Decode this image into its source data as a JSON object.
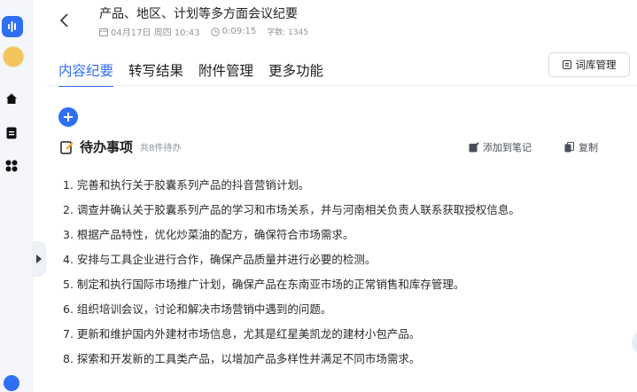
{
  "document": {
    "title": "产品、地区、计划等多方面会议纪要",
    "date": "04月17日 周四 10:43",
    "duration": "0:09:15",
    "word_count": "字数: 1345"
  },
  "tabs": [
    {
      "label": "内容纪要",
      "active": true
    },
    {
      "label": "转写结果",
      "active": false
    },
    {
      "label": "附件管理",
      "active": false
    },
    {
      "label": "更多功能",
      "active": false
    }
  ],
  "toolbar": {
    "library_label": "词库管理"
  },
  "section": {
    "title": "待办事项",
    "subtitle": "共8件待办",
    "add_note_label": "添加到笔记",
    "copy_label": "复制"
  },
  "todos": [
    "1. 完善和执行关于胶囊系列产品的抖音营销计划。",
    "2. 调查并确认关于胶囊系列产品的学习和市场关系，并与河南相关负责人联系获取授权信息。",
    "3. 根据产品特性，优化炒菜油的配方，确保符合市场需求。",
    "4. 安排与工具企业进行合作，确保产品质量并进行必要的检测。",
    "5. 制定和执行国际市场推广计划，确保产品在东南亚市场的正常销售和库存管理。",
    "6. 组织培训会议，讨论和解决市场营销中遇到的问题。",
    "7. 更新和维护国内外建材市场信息，尤其是红星美凯龙的建材小包产品。",
    "8. 探索和开发新的工具类产品，以增加产品多样性并满足不同市场需求。"
  ],
  "colors": {
    "accent": "#2f6ff6",
    "text": "#1f1f1f",
    "muted": "#9096a0"
  },
  "icons": [
    "app-logo-icon",
    "avatar",
    "home-icon",
    "document-icon",
    "apps-grid-icon",
    "back-arrow-icon",
    "calendar-icon",
    "clock-icon",
    "library-icon",
    "plus-icon",
    "edit-note-icon",
    "copy-icon",
    "expand-arrow-icon"
  ]
}
